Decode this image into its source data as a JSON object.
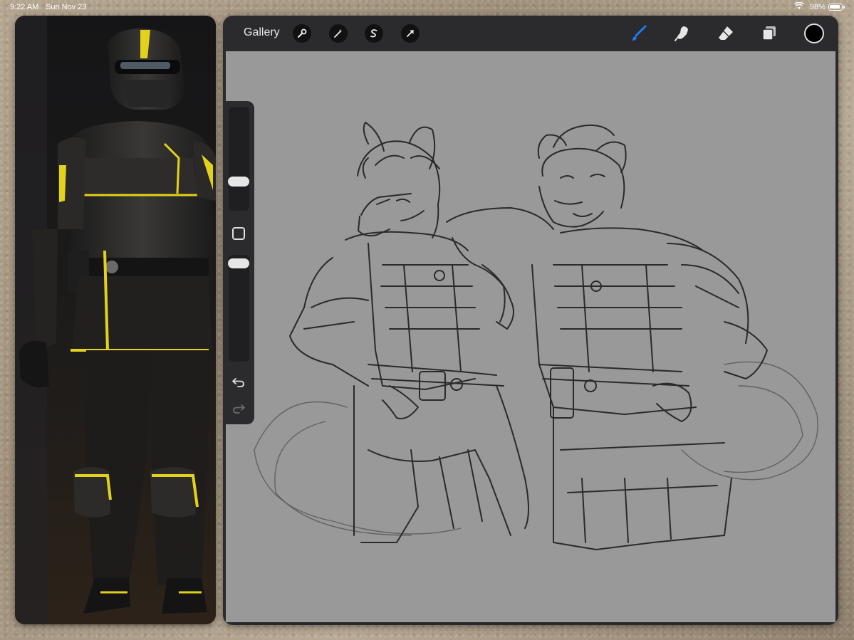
{
  "status_bar": {
    "time": "9:22 AM",
    "date": "Sun Nov 23",
    "battery": "98%"
  },
  "toolbar": {
    "gallery_label": "Gallery",
    "left_tools": [
      "wrench-icon",
      "magic-wand-icon",
      "selection-icon",
      "transform-arrow-icon"
    ],
    "right_tools": [
      "brush-icon",
      "smudge-icon",
      "eraser-icon",
      "layers-icon"
    ],
    "active_tool": "brush-icon",
    "current_color": "#000000"
  },
  "sidebar": {
    "controls": [
      "brush-size-slider",
      "modify-button",
      "opacity-slider",
      "undo-button",
      "redo-button"
    ]
  },
  "colors": {
    "accent": "#1e7cf2",
    "canvas": "#999999",
    "toolbar": "#2b2b2d",
    "reference_highlight": "#e3d21c"
  }
}
